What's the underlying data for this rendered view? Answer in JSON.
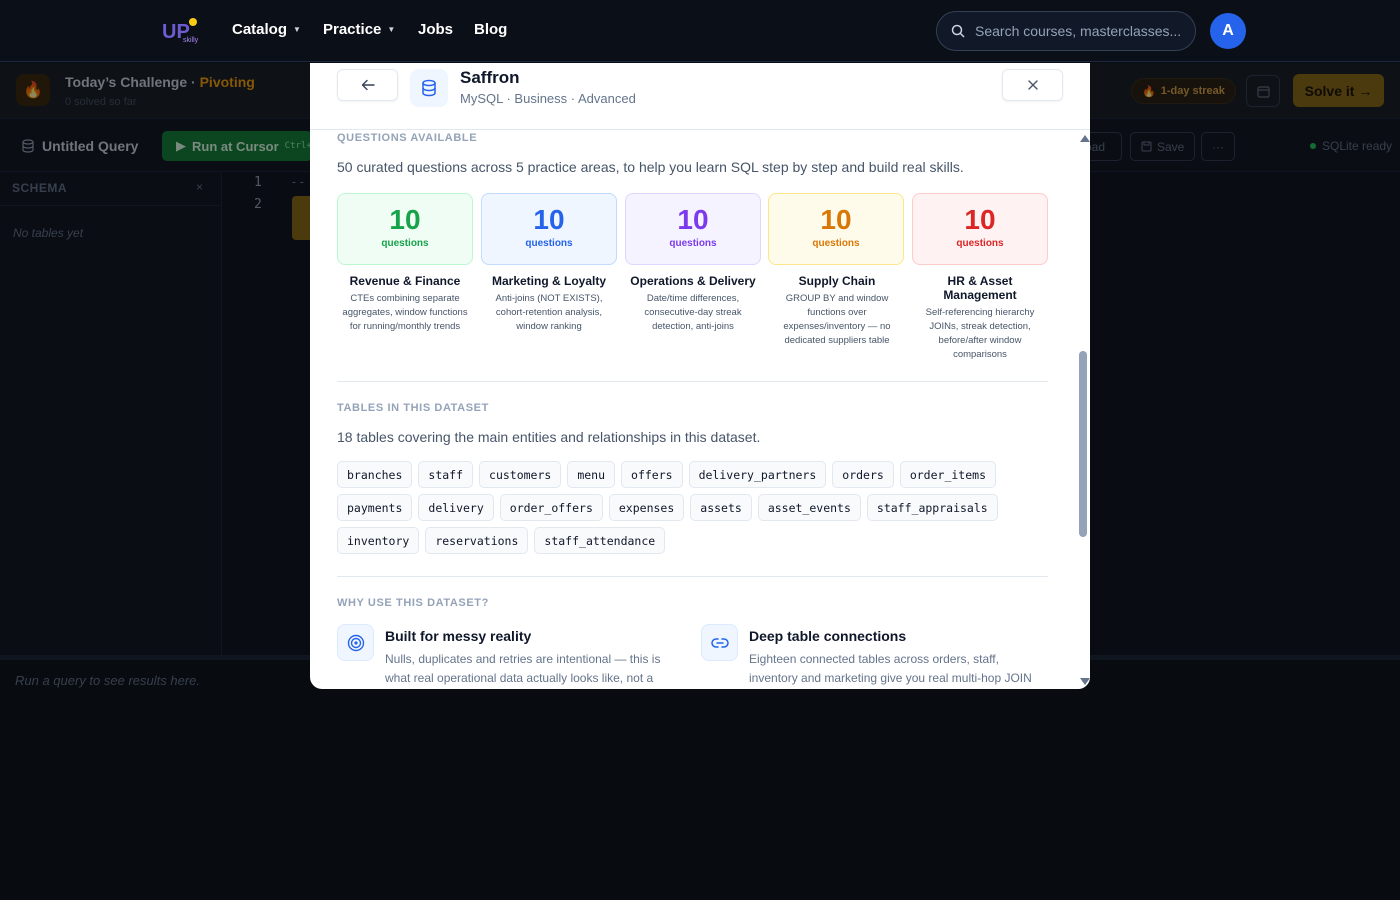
{
  "nav": {
    "logo_text": "UP skilly",
    "links": [
      {
        "label": "Catalog",
        "dropdown": true
      },
      {
        "label": "Practice",
        "dropdown": true
      },
      {
        "label": "Jobs",
        "dropdown": false
      },
      {
        "label": "Blog",
        "dropdown": false
      }
    ],
    "search_placeholder": "Search courses, masterclasses...",
    "avatar_initial": "A"
  },
  "challenge": {
    "title": "Today’s Challenge",
    "separator": " · ",
    "topic": "Pivoting",
    "subtitle": "0 solved so far",
    "streak": "1-day streak",
    "solve_label": "Solve it →"
  },
  "toolbar": {
    "query_title": "Untitled Query",
    "run_label": "Run at Cursor",
    "run_shortcut": "Ctrl+⏎",
    "download_label": "oad",
    "save_label": "Save",
    "more_label": "···",
    "status": "SQLite ready"
  },
  "schema": {
    "heading": "SCHEMA",
    "close": "×",
    "empty": "No tables yet"
  },
  "editor": {
    "line_numbers": [
      "1",
      "2"
    ],
    "line1": "--"
  },
  "results": {
    "empty": "Run a query to see results here."
  },
  "modal": {
    "title": "Saffron",
    "meta": "MySQL · Business · Advanced",
    "questions": {
      "heading": "QUESTIONS AVAILABLE",
      "description": "50 curated questions across 5 practice areas, to help you learn SQL step by step and build real skills.",
      "areas": [
        {
          "count": "10",
          "unit": "questions",
          "title": "Revenue & Finance",
          "desc": "CTEs combining separate aggregates, window functions for running/monthly trends",
          "color": "#16a34a",
          "bg": "#f0fdf4",
          "border": "#bbf7d0"
        },
        {
          "count": "10",
          "unit": "questions",
          "title": "Marketing & Loyalty",
          "desc": "Anti-joins (NOT EXISTS), cohort-retention analysis, window ranking",
          "color": "#2563eb",
          "bg": "#eff6ff",
          "border": "#bfdbfe"
        },
        {
          "count": "10",
          "unit": "questions",
          "title": "Operations & Delivery",
          "desc": "Date/time differences, consecutive-day streak detection, anti-joins",
          "color": "#7c3aed",
          "bg": "#f5f3ff",
          "border": "#ddd6fe"
        },
        {
          "count": "10",
          "unit": "questions",
          "title": "Supply Chain",
          "desc": "GROUP BY and window functions over expenses/inventory — no dedicated suppliers table",
          "color": "#d97706",
          "bg": "#fffbeb",
          "border": "#fde68a"
        },
        {
          "count": "10",
          "unit": "questions",
          "title": "HR & Asset Management",
          "desc": "Self-referencing hierarchy JOINs, streak detection, before/after window comparisons",
          "color": "#dc2626",
          "bg": "#fef2f2",
          "border": "#fecaca"
        }
      ]
    },
    "tables": {
      "heading": "TABLES IN THIS DATASET",
      "description": "18 tables covering the main entities and relationships in this dataset.",
      "names": [
        "branches",
        "staff",
        "customers",
        "menu",
        "offers",
        "delivery_partners",
        "orders",
        "order_items",
        "payments",
        "delivery",
        "order_offers",
        "expenses",
        "assets",
        "asset_events",
        "staff_appraisals",
        "inventory",
        "reservations",
        "staff_attendance"
      ]
    },
    "why": {
      "heading": "WHY USE THIS DATASET?",
      "items": [
        {
          "icon": "target-icon",
          "title": "Built for messy reality",
          "text": "Nulls, duplicates and retries are intentional — this is what real operational data actually looks like, not a"
        },
        {
          "icon": "link-icon",
          "title": "Deep table connections",
          "text": "Eighteen connected tables across orders, staff, inventory and marketing give you real multi-hop JOIN practice."
        }
      ]
    }
  }
}
